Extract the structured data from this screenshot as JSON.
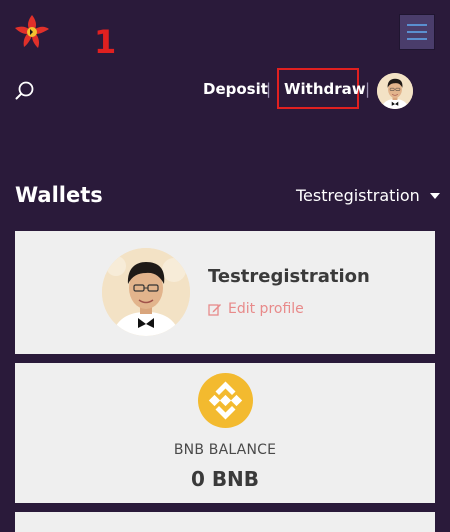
{
  "header": {
    "logo_icon": "star-logo-icon",
    "annotation_number": "1",
    "menu_icon": "hamburger-menu-icon",
    "search_icon": "search-icon",
    "nav": {
      "deposit_label": "Deposit",
      "separator": "|",
      "withdraw_label": "Withdraw"
    },
    "avatar_icon": "user-avatar"
  },
  "wallets": {
    "title": "Wallets",
    "selected_account": "Testregistration"
  },
  "profile": {
    "name": "Testregistration",
    "edit_label": "Edit profile"
  },
  "balance": {
    "coin_icon": "bnb-coin-icon",
    "label": "BNB BALANCE",
    "value": "0 BNB"
  },
  "colors": {
    "background": "#2a1a3a",
    "card": "#efefef",
    "highlight": "#e02020",
    "bnb": "#f3ba2f",
    "edit_link": "#e88a8a"
  }
}
